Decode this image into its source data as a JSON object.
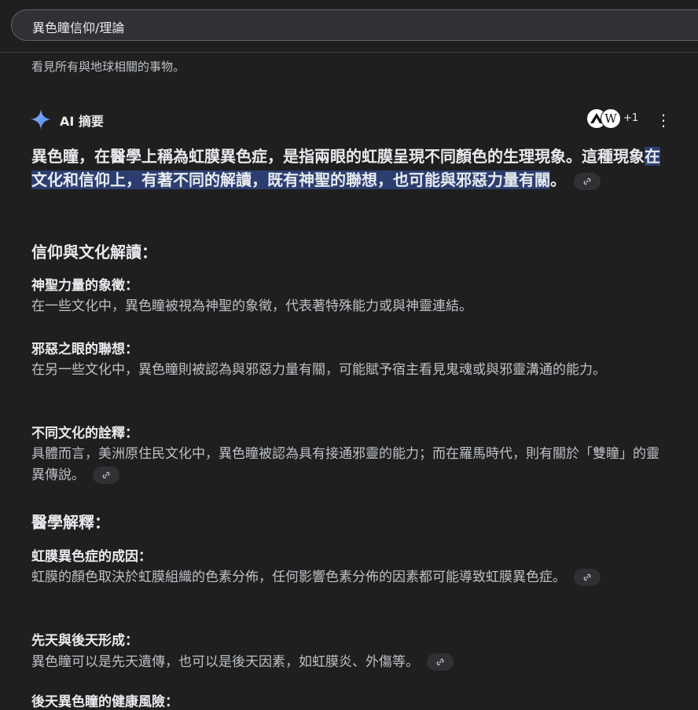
{
  "search": {
    "query": "異色瞳信仰/理論"
  },
  "snippet_text": "看見所有與地球相關的事物。",
  "ai_overview": {
    "label": "AI 摘要",
    "sources_more": "+1",
    "source_icon_2": "W",
    "lead_pre": "異色瞳，在醫學上稱為虹膜異色症，是指兩眼的虹膜呈現不同顏色的生理現象。這種現象",
    "lead_highlight": "在文化和信仰上，有著不同的解讀，既有神聖的聯想，也可能與邪惡力量有關",
    "lead_post": "。",
    "sections": {
      "culture": {
        "heading": "信仰與文化解讀：",
        "items": [
          {
            "title": "神聖力量的象徵：",
            "text": "在一些文化中，異色瞳被視為神聖的象徵，代表著特殊能力或與神靈連結。"
          },
          {
            "title": "邪惡之眼的聯想：",
            "text": "在另一些文化中，異色瞳則被認為與邪惡力量有關，可能賦予宿主看見鬼魂或與邪靈溝通的能力。"
          },
          {
            "title": "不同文化的詮釋：",
            "text": "具體而言，美洲原住民文化中，異色瞳被認為具有接通邪靈的能力；而在羅馬時代，則有關於「雙瞳」的靈異傳說。"
          }
        ]
      },
      "medical": {
        "heading": "醫學解釋：",
        "items": [
          {
            "title": "虹膜異色症的成因：",
            "text": "虹膜的顏色取決於虹膜組織的色素分佈，任何影響色素分佈的因素都可能導致虹膜異色症。"
          },
          {
            "title": "先天與後天形成：",
            "text": "異色瞳可以是先天遺傳，也可以是後天因素，如虹膜炎、外傷等。"
          },
          {
            "title": "後天異色瞳的健康風險：",
            "text": ""
          }
        ]
      }
    }
  },
  "colors": {
    "background": "#1f1f1f",
    "highlight": "#2c3e70",
    "chip": "#303134"
  }
}
